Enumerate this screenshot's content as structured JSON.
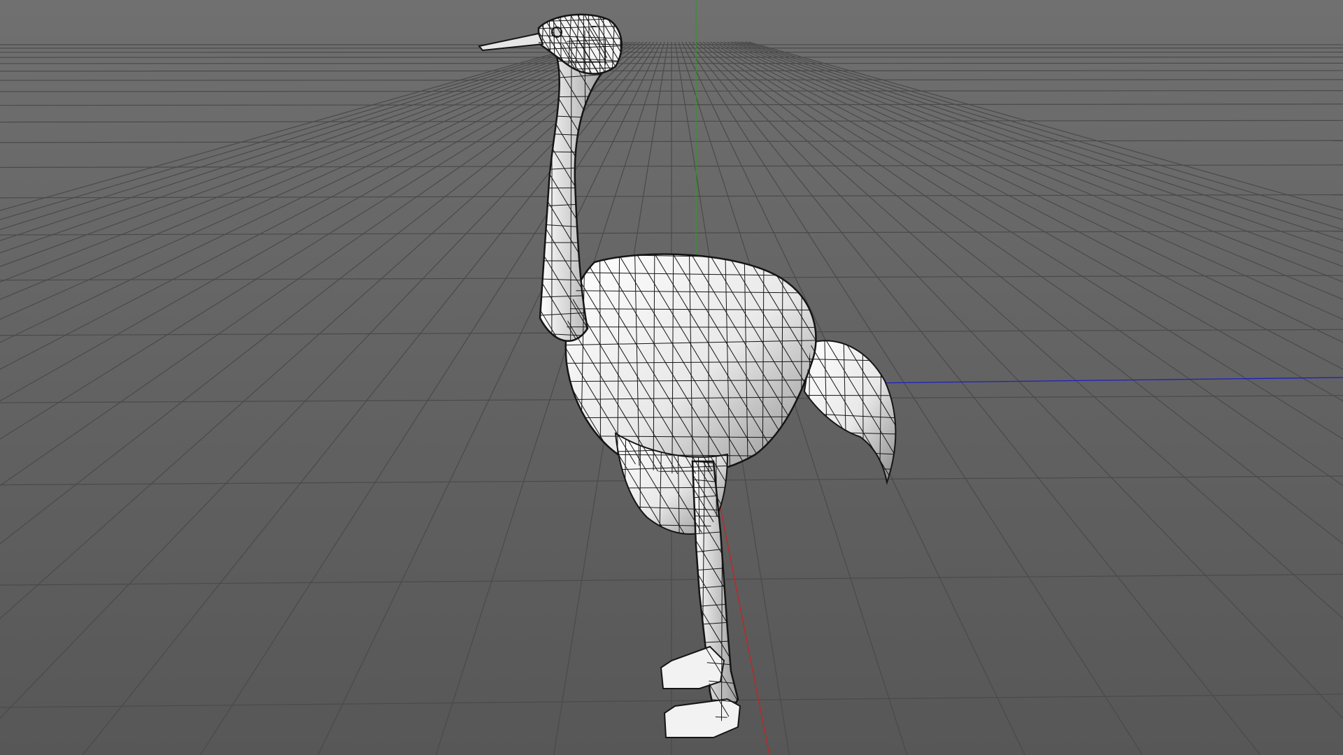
{
  "viewport": {
    "background": "#656565",
    "grid_color": "#4a4a4a",
    "axes": {
      "x_axis_color": "#cc2020",
      "y_axis_color": "#20a020",
      "z_axis_color": "#2020c0"
    }
  },
  "model": {
    "object": "ostrich-mesh",
    "display_mode": "shaded-wireframe",
    "surface_color": "#f2f2f2",
    "edge_color": "#151515"
  }
}
